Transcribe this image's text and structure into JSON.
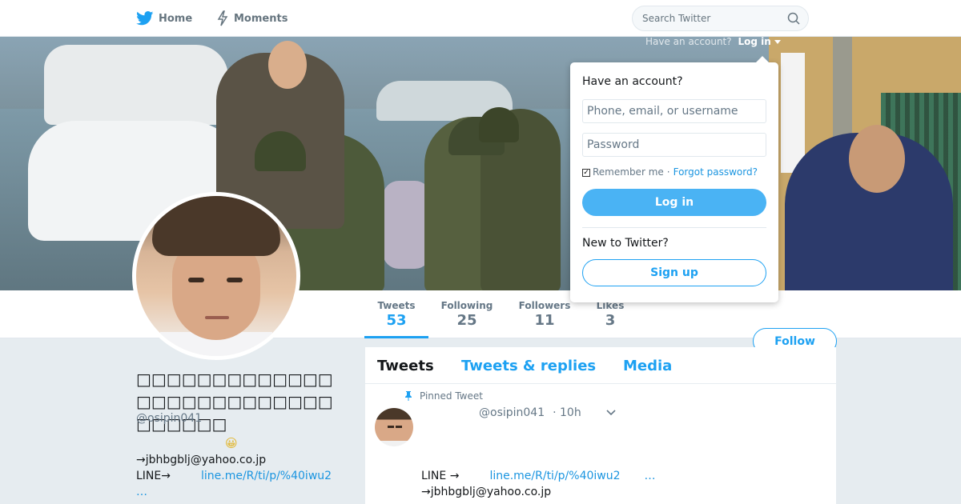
{
  "nav": {
    "home_label": "Home",
    "moments_label": "Moments",
    "search_placeholder": "Search Twitter"
  },
  "login_hint": {
    "text": "Have an account?",
    "login_label": "Log in"
  },
  "profile_nav": {
    "stats": [
      {
        "label": "Tweets",
        "value": "53"
      },
      {
        "label": "Following",
        "value": "25"
      },
      {
        "label": "Followers",
        "value": "11"
      },
      {
        "label": "Likes",
        "value": "3"
      }
    ],
    "follow_label": "Follow"
  },
  "profile": {
    "name": "□□□□□□□□□□□□□□□□□□□□□□□□□□□□□□□□",
    "screen_name": "@osipin041",
    "bio_emoji": "😀",
    "bio_line1": "→jbhbgblj@yahoo.co.jp",
    "bio_line2_prefix": "LINE→",
    "bio_line2_link": "line.me/R/ti/p/%40iwu2",
    "bio_more": "…"
  },
  "timeline": {
    "tabs": [
      {
        "label": "Tweets"
      },
      {
        "label": "Tweets & replies"
      },
      {
        "label": "Media"
      }
    ],
    "pinned_label": "Pinned Tweet",
    "tweet": {
      "screen_name": "@osipin041",
      "time": "· 10h",
      "text1_prefix": "LINE →",
      "text1_link": "line.me/R/ti/p/%40iwu2",
      "text1_ellipsis": "…",
      "text2": "→jbhbgblj@yahoo.co.jp"
    }
  },
  "login_dropdown": {
    "title": "Have an account?",
    "username_placeholder": "Phone, email, or username",
    "password_placeholder": "Password",
    "remember_label": "Remember me",
    "separator": "·",
    "forgot_label": "Forgot password?",
    "login_button": "Log in",
    "new_label": "New to Twitter?",
    "signup_button": "Sign up"
  },
  "colors": {
    "accent": "#1da1f2",
    "link": "#1b95e0",
    "login_button": "#4ab3f4",
    "page_background": "#e6ecf0"
  },
  "icons": [
    "twitter-bird-icon",
    "lightning-icon",
    "search-icon",
    "pin-icon",
    "chevron-down-icon",
    "caret-down-icon",
    "checkbox-icon"
  ]
}
